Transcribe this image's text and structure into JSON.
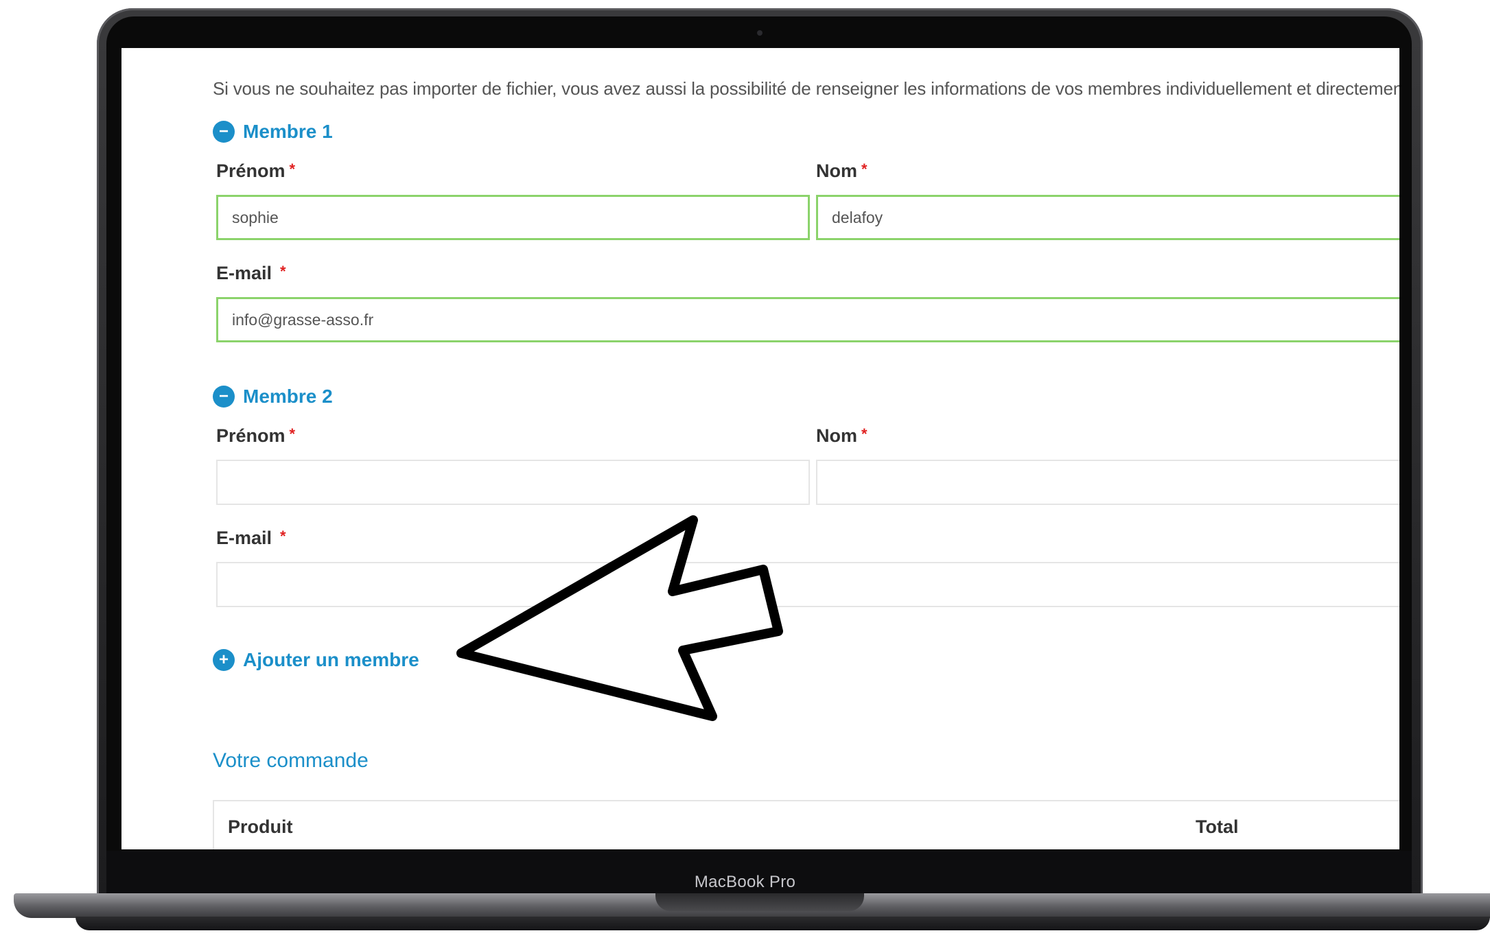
{
  "device": {
    "brand_label": "MacBook Pro"
  },
  "page": {
    "intro_text": "Si vous ne souhaitez pas importer de fichier, vous avez aussi la possibilité de renseigner les informations de vos membres individuellement et directement s",
    "accent_color": "#1b8fc9",
    "valid_border_color": "#8bd36b",
    "required_color": "#e02020"
  },
  "members": [
    {
      "toggle_icon": "−",
      "title": "Membre 1",
      "first_name_label": "Prénom",
      "last_name_label": "Nom",
      "email_label": "E-mail",
      "required_mark": "*",
      "first_name_value": "sophie",
      "last_name_value": "delafoy",
      "email_value": "info@grasse-asso.fr"
    },
    {
      "toggle_icon": "−",
      "title": "Membre 2",
      "first_name_label": "Prénom",
      "last_name_label": "Nom",
      "email_label": "E-mail",
      "required_mark": "*",
      "first_name_value": "",
      "last_name_value": "",
      "email_value": ""
    }
  ],
  "add_member": {
    "icon": "+",
    "label": "Ajouter un membre"
  },
  "order": {
    "title": "Votre commande",
    "columns": [
      "Produit",
      "Total"
    ]
  }
}
